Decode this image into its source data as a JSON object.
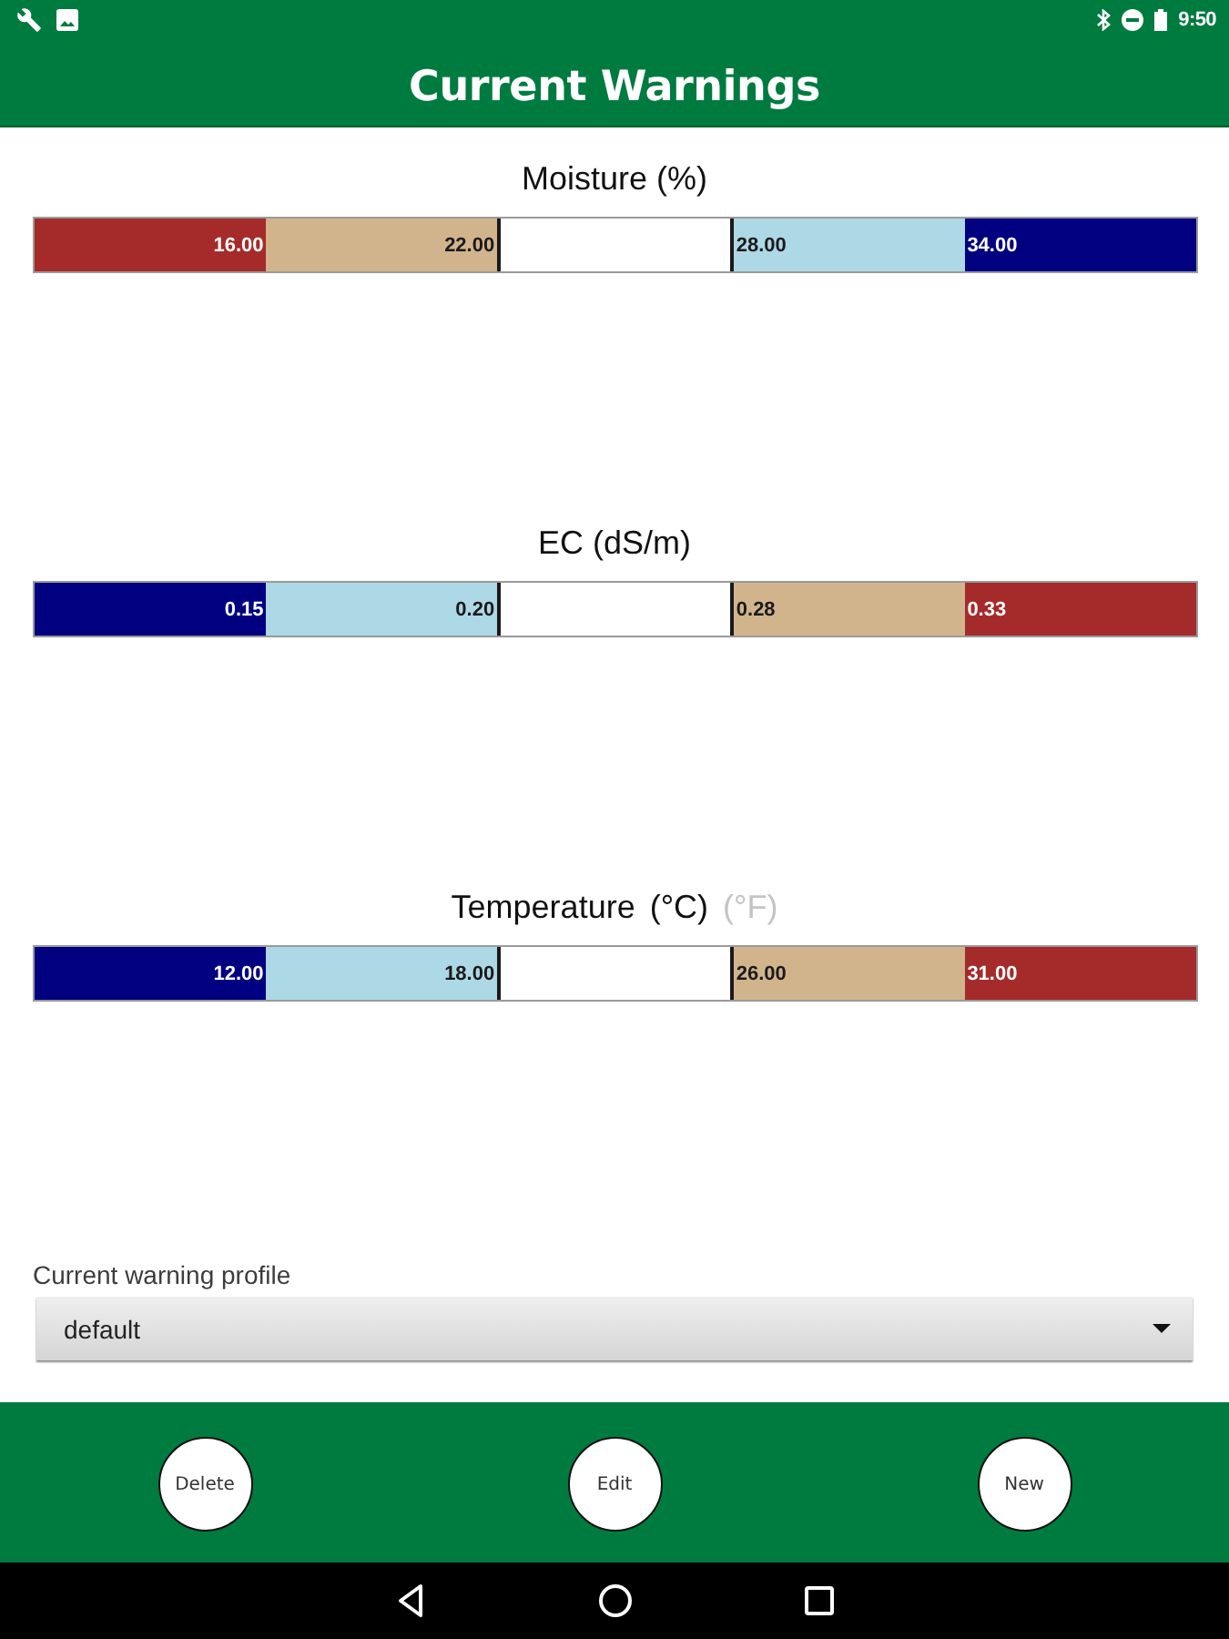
{
  "status_bar": {
    "time": "9:50"
  },
  "app_bar": {
    "title": "Current Warnings"
  },
  "gauges": [
    {
      "title": "Moisture (%)",
      "segments": [
        {
          "color": "#a52a2a",
          "value": "16.00"
        },
        {
          "color": "#d2b48c",
          "value": "22.00"
        },
        {
          "color": "#ffffff"
        },
        {
          "color": "#add8e6",
          "value": "28.00"
        },
        {
          "color": "#000080",
          "value": "34.00"
        }
      ]
    },
    {
      "title": "EC (dS/m)",
      "segments": [
        {
          "color": "#000080",
          "value": "0.15"
        },
        {
          "color": "#add8e6",
          "value": "0.20"
        },
        {
          "color": "#ffffff"
        },
        {
          "color": "#d2b48c",
          "value": "0.28"
        },
        {
          "color": "#a52a2a",
          "value": "0.33"
        }
      ]
    },
    {
      "title": "Temperature",
      "units": [
        {
          "label": "(°C)",
          "selected": true
        },
        {
          "label": "(°F)",
          "selected": false
        }
      ],
      "segments": [
        {
          "color": "#000080",
          "value": "12.00"
        },
        {
          "color": "#add8e6",
          "value": "18.00"
        },
        {
          "color": "#ffffff"
        },
        {
          "color": "#d2b48c",
          "value": "26.00"
        },
        {
          "color": "#a52a2a",
          "value": "31.00"
        }
      ]
    }
  ],
  "profile": {
    "label": "Current warning profile",
    "value": "default"
  },
  "buttons": [
    "Delete",
    "Edit",
    "New"
  ]
}
